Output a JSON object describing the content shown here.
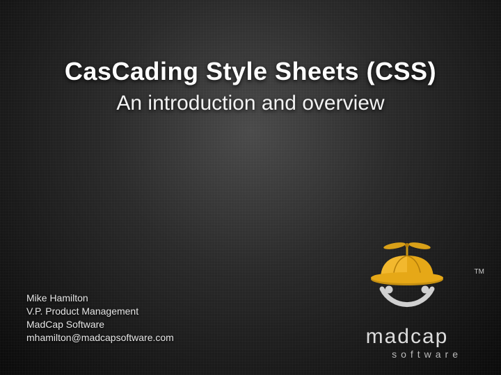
{
  "title": "CasCading Style Sheets (CSS)",
  "subtitle": "An introduction and overview",
  "author": {
    "name": "Mike Hamilton",
    "role": "V.P. Product Management",
    "company": "MadCap Software",
    "email": "mhamilton@madcapsoftware.com"
  },
  "logo": {
    "name": "madcap",
    "sub": "software",
    "trademark": "TM"
  },
  "colors": {
    "cap": "#e6a817",
    "cap_dark": "#b37d0a",
    "propeller": "#d9a018",
    "face_stroke": "#d0d0d0"
  }
}
